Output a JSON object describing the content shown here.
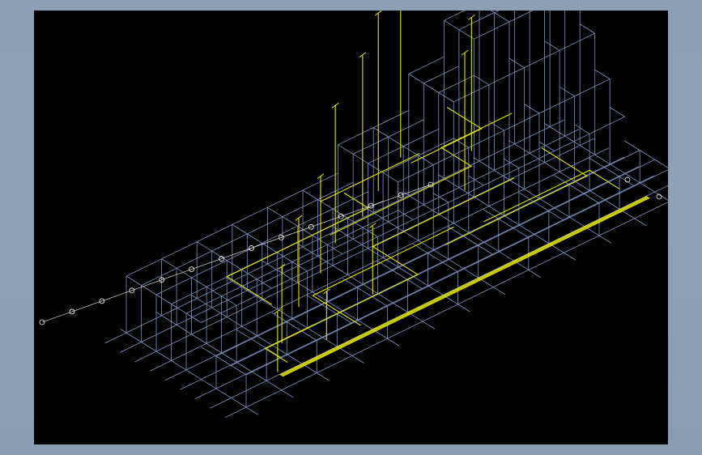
{
  "drawing": {
    "background_color": "#000000",
    "frame_color": "#8d9fb6",
    "grid_color": "#7f95c7",
    "pipe_color": "#e6e600",
    "dimension_color": "#ffffff",
    "grid_bubble_count": 14
  }
}
